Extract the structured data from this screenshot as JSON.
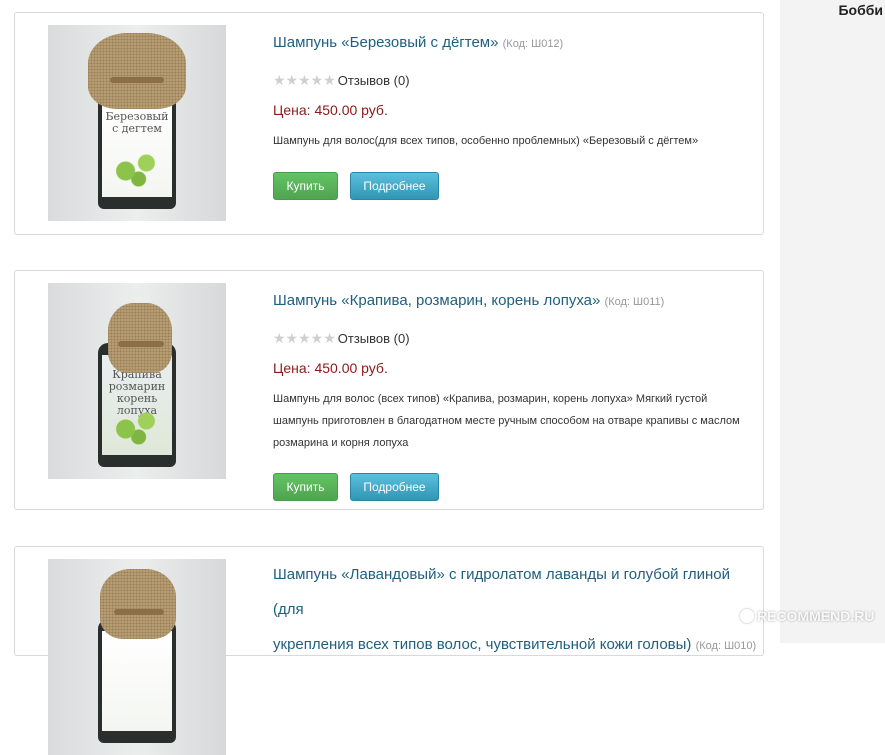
{
  "user": {
    "name": "Бобби"
  },
  "products": [
    {
      "title": "Шампунь «Березовый с дёгтем»",
      "code": "(Код: Ш012)",
      "reviews": "Отзывов (0)",
      "rating": 0,
      "price": "Цена: 450.00 руб.",
      "description_lines": [
        "Шампунь для волос(для всех типов, особенно проблемных) «Березовый с дёгтем»"
      ],
      "buy_label": "Купить",
      "more_label": "Подробнее",
      "image_icon": "shampoo-bottle-birch-tar"
    },
    {
      "title": "Шампунь «Крапива, розмарин, корень лопуха»",
      "code": "(Код: Ш011)",
      "reviews": "Отзывов (0)",
      "rating": 0,
      "price": "Цена: 450.00 руб.",
      "description_lines": [
        "Шампунь для волос (всех типов) «Крапива, розмарин, корень лопуха» Мягкий густой",
        "шампунь приготовлен в благодатном месте ручным способом на отваре крапивы с маслом",
        "розмарина и корня лопуха"
      ],
      "buy_label": "Купить",
      "more_label": "Подробнее",
      "image_icon": "shampoo-bottle-nettle"
    },
    {
      "title_lines": [
        "Шампунь «Лавандовый» с гидролатом лаванды и голубой глиной (для",
        "укрепления всех типов волос, чувствительной кожи головы)"
      ],
      "code": "(Код: Ш010)",
      "image_icon": "shampoo-bottle-lavender"
    }
  ],
  "watermark": {
    "text": "RECOMMEND.RU"
  },
  "colors": {
    "title": "#1f5f7f",
    "price": "#8b1a1a",
    "buy_button": "#5cb85c",
    "more_button": "#3ba9cf"
  }
}
